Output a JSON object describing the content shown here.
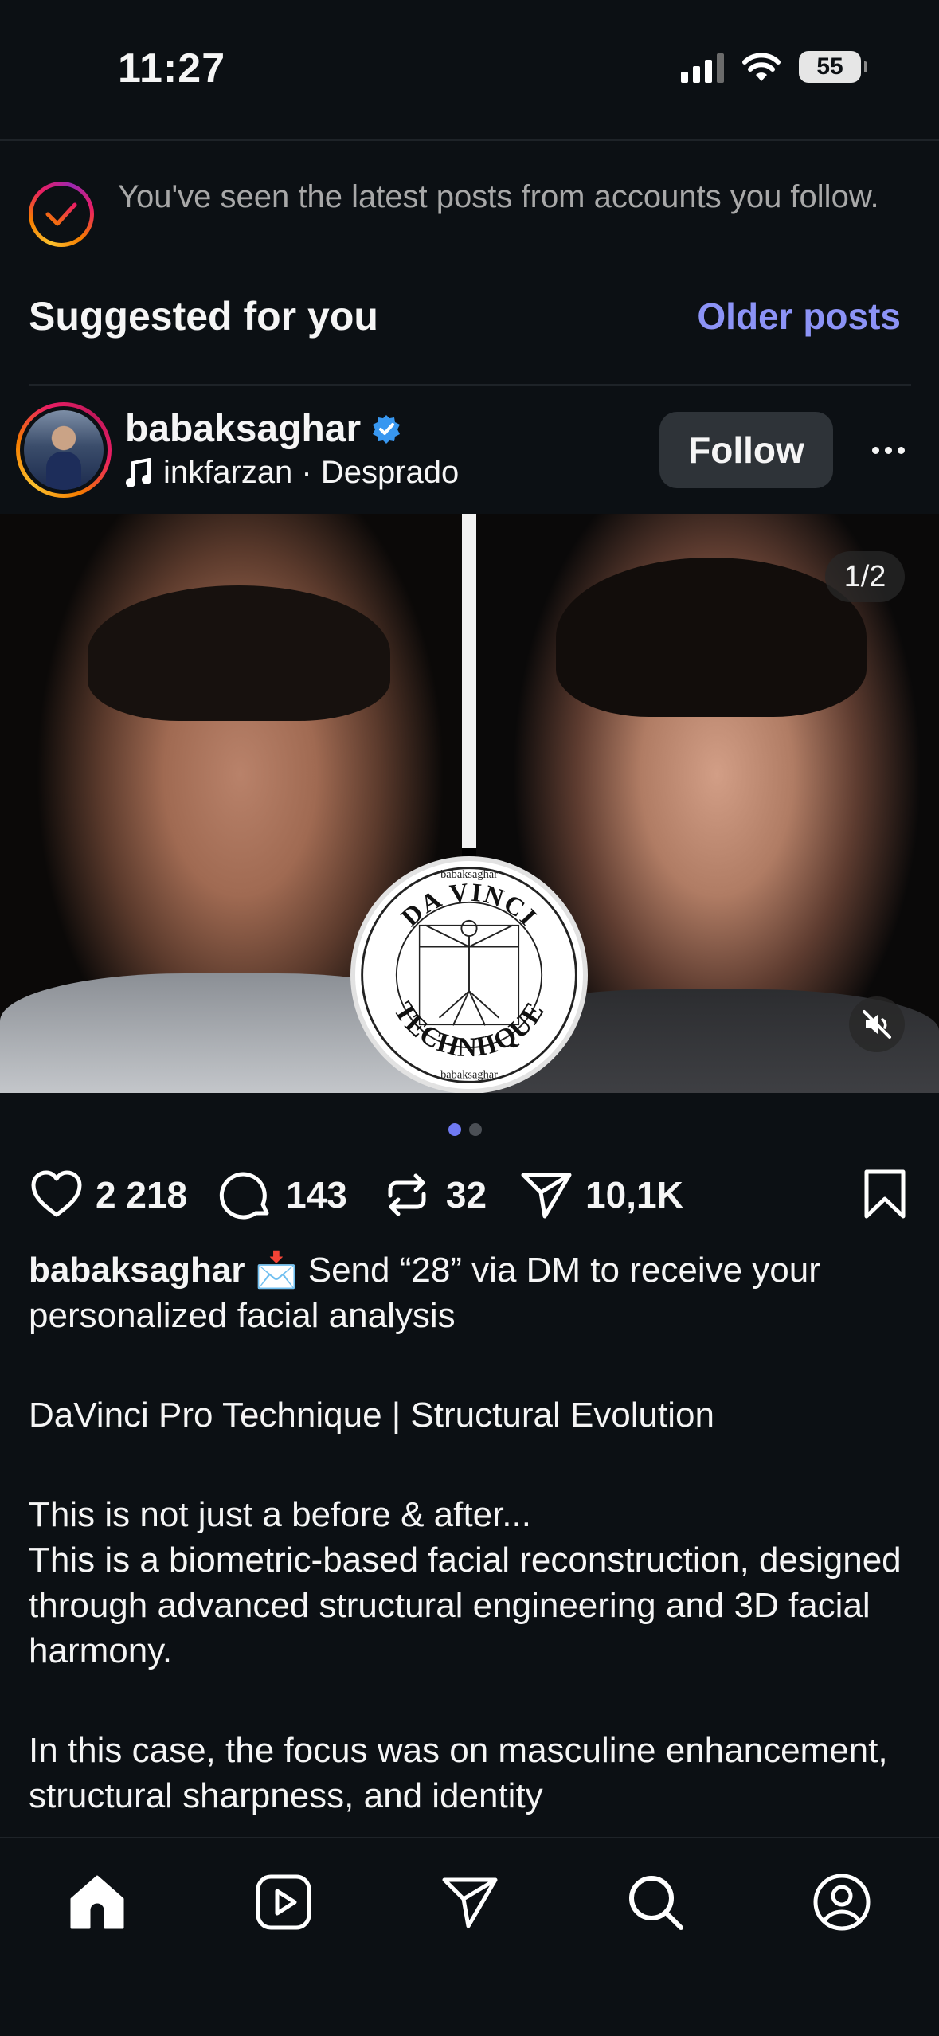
{
  "status_bar": {
    "time": "11:27",
    "battery": "55",
    "icons": [
      "signal-icon",
      "wifi-icon",
      "battery-icon"
    ]
  },
  "feed_notice": {
    "message": "You've seen the latest posts from accounts you follow.",
    "icon": "check-circle-icon"
  },
  "suggested": {
    "title": "Suggested for you",
    "older_posts_link": "Older posts"
  },
  "post": {
    "username": "babaksaghar",
    "verified": true,
    "audio": "inkfarzan · Desprado",
    "follow_label": "Follow",
    "more_icon": "more-horizontal-icon",
    "media": {
      "page_indicator": "1/2",
      "slide_count": 2,
      "active_slide": 1,
      "mute_icon": "muted-speaker-icon",
      "badge_text_top": "DA VINCI",
      "badge_text_bottom": "TECHNIIQUE",
      "badge_small": "babaksaghar"
    },
    "actions": {
      "likes": "2 218",
      "comments": "143",
      "reposts": "32",
      "shares": "10,1K"
    },
    "caption": {
      "username": "babaksaghar",
      "emoji": "📩",
      "line1": " Send “28” via DM to receive your personalized facial analysis",
      "para2": "DaVinci Pro Technique | Structural Evolution",
      "para3a": "This is not just a before & after...",
      "para3b": "This is a biometric-based facial reconstruction, designed through advanced structural engineering and 3D facial harmony.",
      "para4": "In this case, the focus was on masculine enhancement, structural sharpness, and identity"
    }
  },
  "bottom_nav": [
    {
      "name": "home",
      "icon": "home-icon",
      "active": true
    },
    {
      "name": "reels",
      "icon": "reels-icon",
      "active": false
    },
    {
      "name": "messages",
      "icon": "send-icon",
      "active": false
    },
    {
      "name": "search",
      "icon": "search-icon",
      "active": false
    },
    {
      "name": "profile",
      "icon": "profile-icon",
      "active": false
    }
  ],
  "colors": {
    "background": "#0c1014",
    "accent_link": "#8c93f6",
    "follow_button": "#2e3338",
    "verified_blue": "#3897f0"
  }
}
